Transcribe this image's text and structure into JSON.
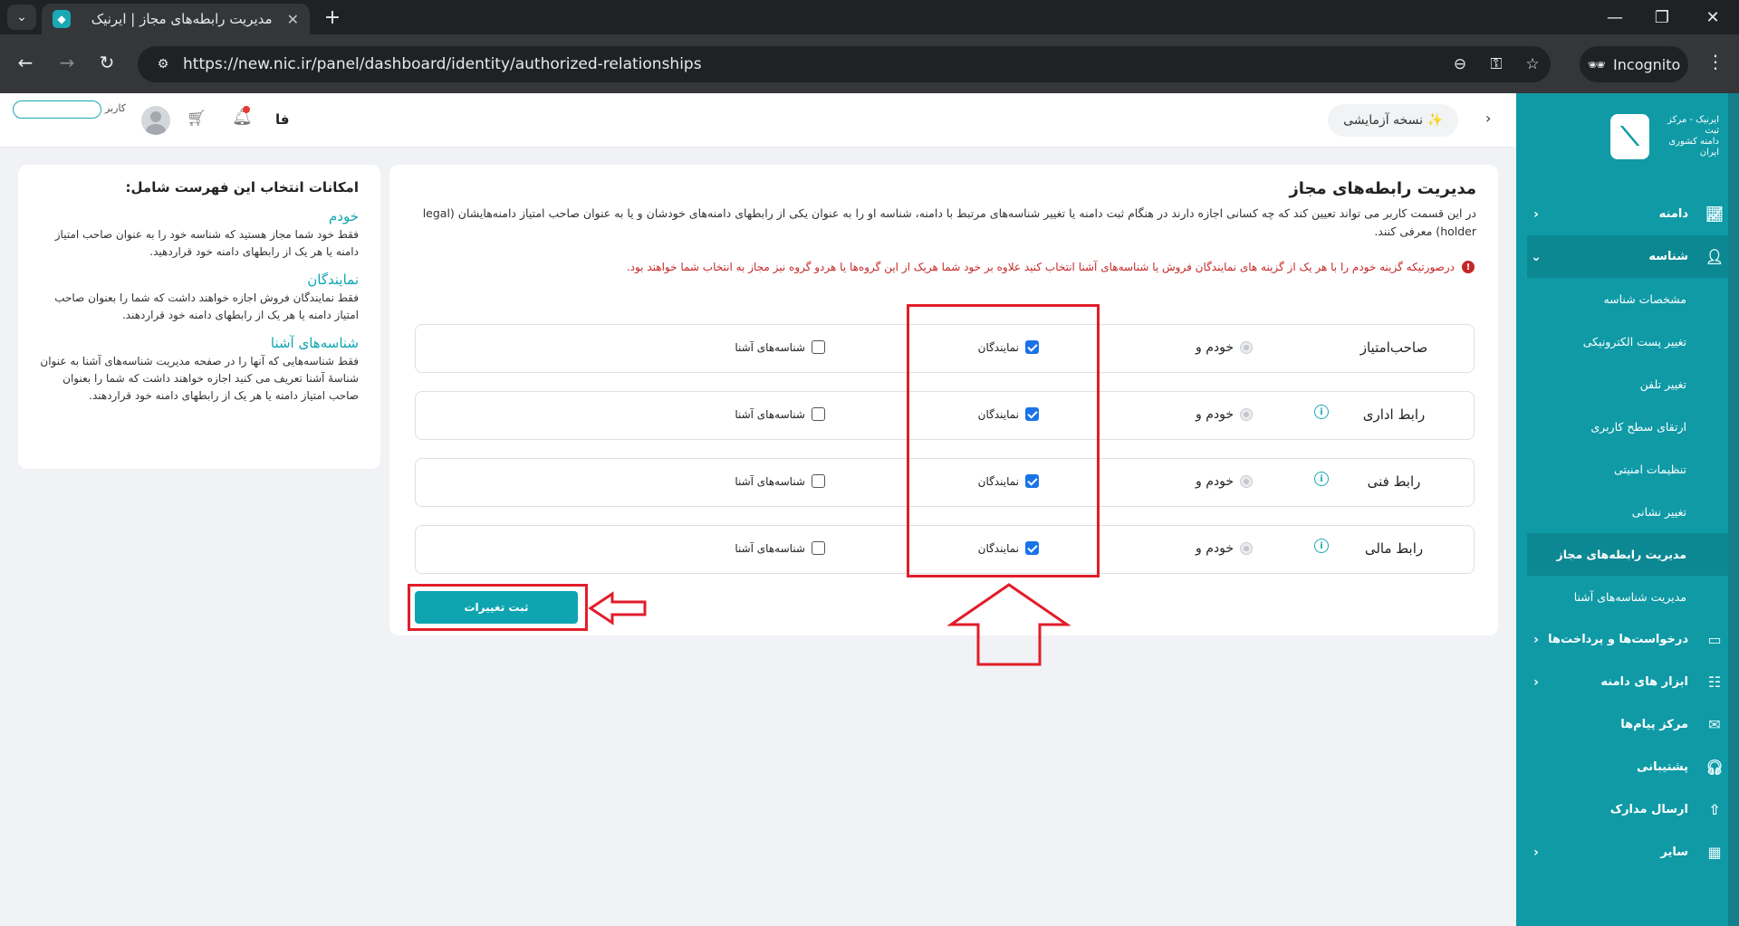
{
  "browser": {
    "tab_title": "مدیریت رابطه‌های مجاز | ایرنیک",
    "url": "https://new.nic.ir/panel/dashboard/identity/authorized-relationships",
    "incognito_label": "Incognito"
  },
  "header": {
    "beta_label": "✨ نسخه آزمایشی",
    "lang": "فا",
    "user_label": "کاربر"
  },
  "logo": {
    "text_line1": "ایرنیک - مرکز ثبت",
    "text_line2": "دامنه کشوری ایران"
  },
  "sidebar": {
    "items": [
      {
        "label": "دامنه",
        "icon": "chart-icon"
      },
      {
        "label": "شناسه",
        "icon": "user-icon"
      },
      {
        "label": "درخواست‌ها و پرداخت‌ها",
        "icon": "card-icon"
      },
      {
        "label": "ابزار های دامنه",
        "icon": "sliders-icon"
      },
      {
        "label": "مرکز پیام‌ها",
        "icon": "message-icon"
      },
      {
        "label": "پشتیبانی",
        "icon": "headset-icon"
      },
      {
        "label": "ارسال مدارک",
        "icon": "upload-icon"
      },
      {
        "label": "سایر",
        "icon": "grid-icon"
      }
    ],
    "sub_items": [
      "مشخصات شناسه",
      "تغییر پست الکترونیکی",
      "تغییر تلفن",
      "ارتقای سطح کاربری",
      "تنظیمات امنیتی",
      "تغییر نشانی",
      "مدیریت رابطه‌های مجاز",
      "مدیریت شناسه‌های آشنا"
    ]
  },
  "main": {
    "title": "مدیریت رابطه‌های مجاز",
    "description": "در این قسمت کاربر می تواند تعیین کند که چه کسانی اجازه دارند در هنگام ثبت دامنه یا تغییر شناسه‌های مرتبط با دامنه، شناسه او را به عنوان یکی از رابطهای دامنه‌های خودشان و یا به عنوان صاحب امتیاز دامنه‌هایشان (legal holder) معرفی کنند.",
    "warning": "درصورتیکه گزینه خودم را با هر یک از گزینه های نمایندگان فروش یا شناسه‌های آشنا انتخاب کنید علاوه بر خود شما هریک از این گروه‌ها یا هردو گروه نیز مجاز به انتخاب شما خواهند بود.",
    "rows": [
      {
        "label": "صاحب‌امتیاز",
        "self": "خودم و",
        "reps": "نمایندگان",
        "known": "شناسه‌های آشنا",
        "reps_checked": true,
        "known_checked": false,
        "has_info": false
      },
      {
        "label": "رابط اداری",
        "self": "خودم و",
        "reps": "نمایندگان",
        "known": "شناسه‌های آشنا",
        "reps_checked": true,
        "known_checked": false,
        "has_info": true
      },
      {
        "label": "رابط فنی",
        "self": "خودم و",
        "reps": "نمایندگان",
        "known": "شناسه‌های آشنا",
        "reps_checked": true,
        "known_checked": false,
        "has_info": true
      },
      {
        "label": "رابط مالی",
        "self": "خودم و",
        "reps": "نمایندگان",
        "known": "شناسه‌های آشنا",
        "reps_checked": true,
        "known_checked": false,
        "has_info": true
      }
    ],
    "submit_label": "ثبت تغییرات"
  },
  "info": {
    "title": "امکانات انتخاب این فهرست شامل:",
    "sections": [
      {
        "heading": "خودم",
        "text": "فقط خود شما مجاز هستید که شناسه خود را به عنوان صاحب امتیاز دامنه یا هر یک از رابطهای دامنه خود قراردهید."
      },
      {
        "heading": "نمایندگان",
        "text": "فقط نمایندگان فروش اجازه خواهند داشت که شما را بعنوان صاحب امتیاز دامنه یا هر یک از رابطهای دامنه خود قراردهند."
      },
      {
        "heading": "شناسه‌های آشنا",
        "text": "فقط شناسه‌هایی که آنها را در صفحه مدیریت شناسه‌های آشنا به عنوان شناسهٔ آشنا تعریف می کنید اجازه خواهند داشت که شما را بعنوان صاحب امتیاز دامنه یا هر یک از رابطهای دامنه خود قراردهند."
      }
    ]
  },
  "colors": {
    "brand": "#0f9aa6",
    "annotation": "#e11d2a",
    "warning": "#c62828"
  }
}
